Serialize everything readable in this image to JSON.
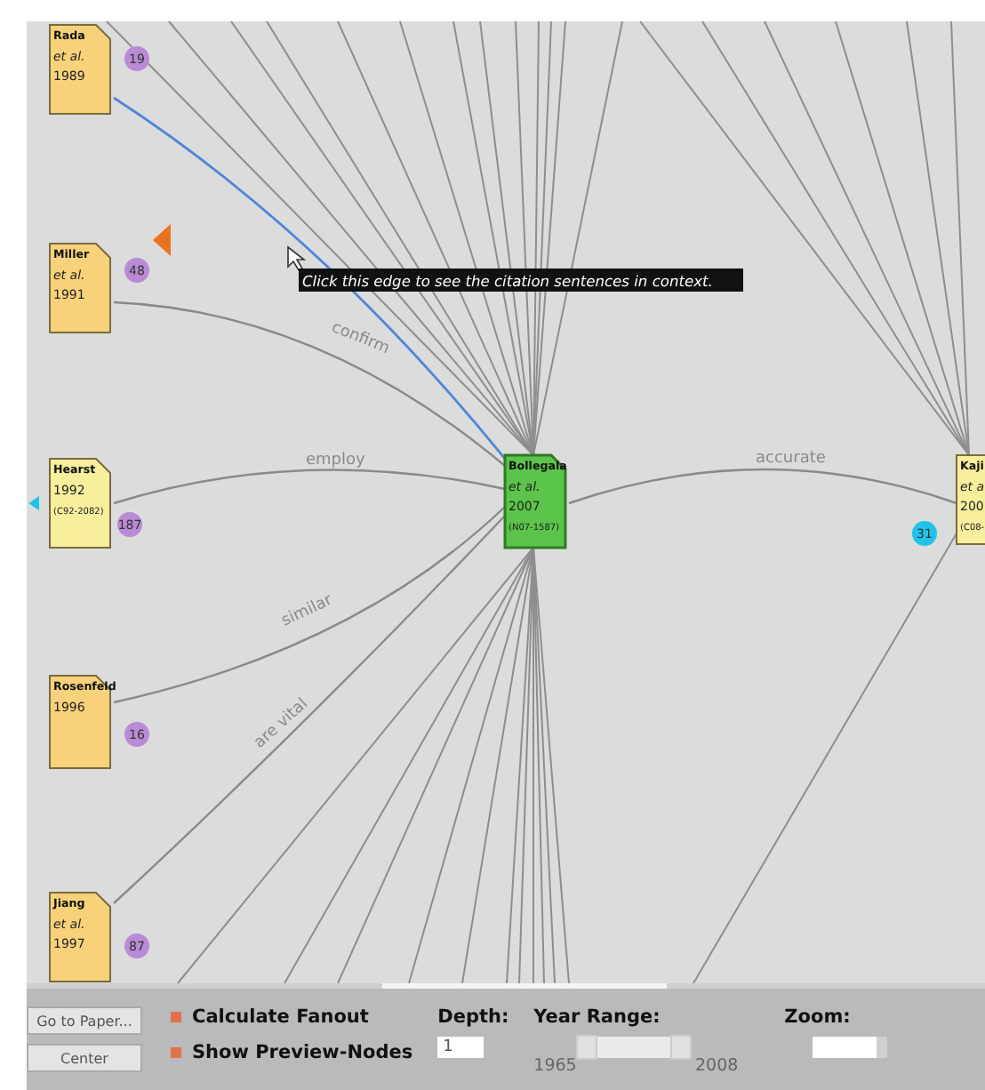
{
  "graph": {
    "tooltip": "Click this edge to see the citation sentences in context.",
    "nodes": [
      {
        "kind": "paper",
        "title": "Rada",
        "lines": [
          "et al.",
          "1989"
        ],
        "color": "#f7d27a",
        "selected": false,
        "badge": {
          "count": "19",
          "color": "#b98ad6"
        }
      },
      {
        "kind": "paper",
        "title": "Miller",
        "lines": [
          "et al.",
          "1991"
        ],
        "color": "#f7d27a",
        "selected": false,
        "badge": {
          "count": "48",
          "color": "#b98ad6"
        }
      },
      {
        "kind": "paper",
        "title": "Hearst",
        "lines": [
          "1992",
          "(C92-2082)"
        ],
        "color": "#f7ef9c",
        "selected": false,
        "badge": {
          "count": "187",
          "color": "#b98ad6"
        }
      },
      {
        "kind": "paper",
        "title": "Rosenfeld",
        "lines": [
          "1996"
        ],
        "color": "#f7d27a",
        "selected": false,
        "badge": {
          "count": "16",
          "color": "#b98ad6"
        }
      },
      {
        "kind": "paper",
        "title": "Jiang",
        "lines": [
          "et al.",
          "1997"
        ],
        "color": "#f7d27a",
        "selected": false,
        "badge": {
          "count": "87",
          "color": "#b98ad6"
        }
      },
      {
        "kind": "paper",
        "title": "Bollegala",
        "lines": [
          "et al.",
          "2007",
          "(N07-1587)"
        ],
        "color": "#5cc44a",
        "selected": true
      },
      {
        "kind": "paper",
        "title": "Kaji",
        "lines": [
          "et a",
          "200",
          "(C08-"
        ],
        "color": "#f7ef9c",
        "selected": false,
        "badge": {
          "count": "31",
          "color": "#22c3ea"
        }
      }
    ],
    "edges": [
      {
        "label": "confirm",
        "highlighted": false
      },
      {
        "label": "employ",
        "highlighted": false
      },
      {
        "label": "similar",
        "highlighted": false
      },
      {
        "label": "are vital",
        "highlighted": false
      },
      {
        "label": "accurate",
        "highlighted": false
      },
      {
        "highlighted": true
      }
    ]
  },
  "controls": {
    "buttons": [
      "Go to Paper...",
      "Center"
    ],
    "checkboxes": [
      {
        "label": "Calculate Fanout",
        "checked": true
      },
      {
        "label": "Show Preview-Nodes",
        "checked": true
      }
    ],
    "depth": {
      "label": "Depth:",
      "value": "1"
    },
    "year_range": {
      "label": "Year Range:",
      "from": "1965",
      "to": "2008",
      "thumbs": [
        {
          "level": 0.0
        },
        {
          "level": 1.0
        }
      ]
    },
    "zoom": {
      "label": "Zoom:",
      "level": 0.85
    }
  }
}
